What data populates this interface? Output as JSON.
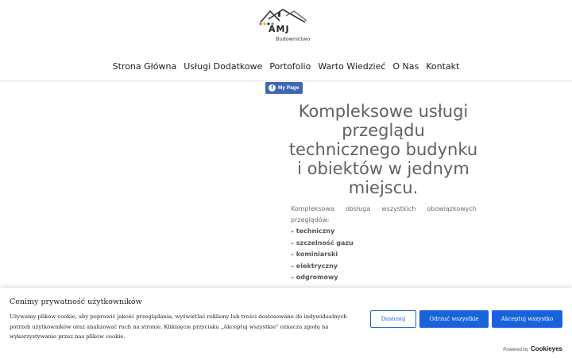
{
  "header": {
    "logo": {
      "name": "AMJ",
      "tagline": "Budownictwo"
    },
    "nav": [
      "Strona Główna",
      "Usługi Dodatkowe",
      "Portofolio",
      "Warto Wiedzieć",
      "O Nas",
      "Kontakt"
    ]
  },
  "fb_badge": {
    "label": "My Page",
    "icon": "facebook-icon",
    "color": "#4267b2"
  },
  "main": {
    "title": "Kompleksowe usługi przeglądu technicznego budynku i obiektów w jednym miejscu.",
    "description": "Kompleksowa obsługa wszystkich obowiązkowych przeglądów:",
    "services": [
      "– techniczny",
      "– szczelność gazu",
      "– kominiarski",
      "– elektryczny",
      "– odgromowy"
    ]
  },
  "cookie_banner": {
    "title": "Cenimy prywatność użytkowników",
    "text": "Używamy plików cookie, aby poprawić jakość przeglądania, wyświetlać reklamy lub treści dostosowane do indywidualnych potrzeb użytkowników oraz analizować ruch na stronie. Kliknięcie przycisku „Akceptuj wszystkie” oznacza zgodę na wykorzystywanie przez nas plików cookie.",
    "buttons": {
      "customize": "Dostosuj",
      "reject": "Odrzuć wszystkie",
      "accept": "Akceptuj wszystko"
    },
    "powered_by": "Powered by",
    "brand": "Cookieyes",
    "accent_color": "#1863dc"
  }
}
